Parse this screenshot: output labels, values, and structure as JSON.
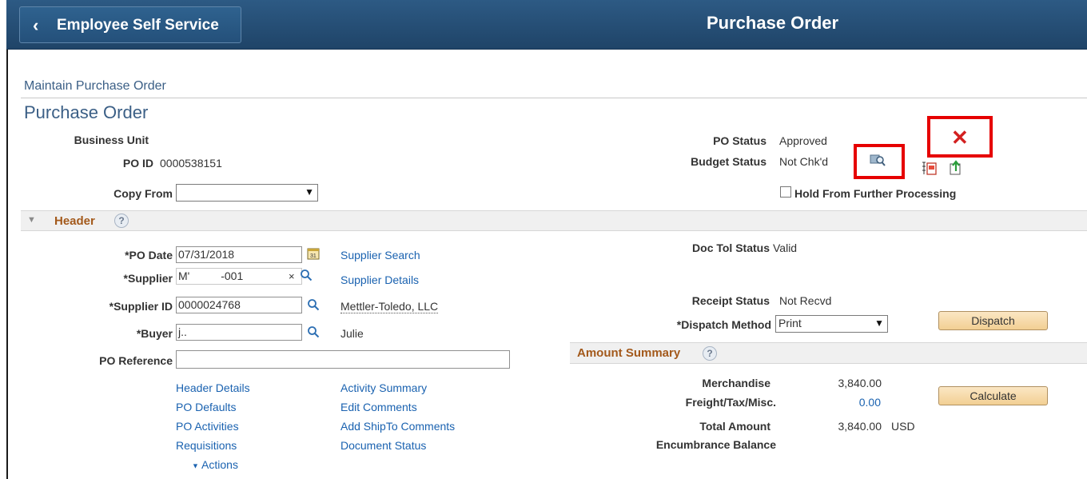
{
  "topbar": {
    "back_label": "Employee Self Service",
    "back_chevron": "‹",
    "page_title": "Purchase Order"
  },
  "breadcrumb": "Maintain Purchase Order",
  "title": "Purchase Order",
  "fields": {
    "business_unit_label": "Business Unit",
    "business_unit_value": "",
    "po_id_label": "PO ID",
    "po_id_value": "0000538151",
    "copy_from_label": "Copy From",
    "copy_from_value": ""
  },
  "status": {
    "po_status_label": "PO Status",
    "po_status_value": "Approved",
    "budget_status_label": "Budget Status",
    "budget_status_value": "Not Chk'd",
    "hold_label": "Hold From Further Processing"
  },
  "header_section": {
    "title": "Header",
    "po_date_label": "*PO Date",
    "po_date_value": "07/31/2018",
    "supplier_search": "Supplier Search",
    "supplier_label": "*Supplier",
    "supplier_value": "M'          -001",
    "supplier_details": "Supplier Details",
    "supplier_id_label": "*Supplier ID",
    "supplier_id_value": "0000024768",
    "supplier_name": "Mettler-Toledo, LLC",
    "buyer_label": "*Buyer",
    "buyer_value": "j..",
    "buyer_name": "Julie",
    "po_reference_label": "PO Reference",
    "po_reference_value": "",
    "doc_tol_label": "Doc Tol Status",
    "doc_tol_value": "Valid",
    "receipt_status_label": "Receipt Status",
    "receipt_status_value": "Not Recvd",
    "dispatch_method_label": "*Dispatch Method",
    "dispatch_method_value": "Print",
    "dispatch_button": "Dispatch"
  },
  "links_left": [
    "Header Details",
    "PO Defaults",
    "PO Activities",
    "Requisitions"
  ],
  "links_right": [
    "Activity Summary",
    "Edit Comments",
    "Add ShipTo Comments",
    "Document Status"
  ],
  "actions_label": "Actions",
  "amount_summary": {
    "title": "Amount Summary",
    "merchandise_label": "Merchandise",
    "merchandise_value": "3,840.00",
    "freight_label": "Freight/Tax/Misc.",
    "freight_value": "0.00",
    "total_label": "Total Amount",
    "total_value": "3,840.00",
    "currency": "USD",
    "encumbrance_label": "Encumbrance Balance",
    "calculate_button": "Calculate"
  },
  "colors": {
    "header_blue": "#1f4468",
    "link_blue": "#1a62b0",
    "section_orange": "#a3591b",
    "highlight_red": "#e60000"
  },
  "icons": [
    "chevron-left-icon",
    "calendar-icon",
    "search-icon",
    "clear-icon",
    "budget-check-icon",
    "document-icon",
    "export-icon",
    "close-x-icon",
    "help-icon",
    "collapse-triangle-icon"
  ]
}
